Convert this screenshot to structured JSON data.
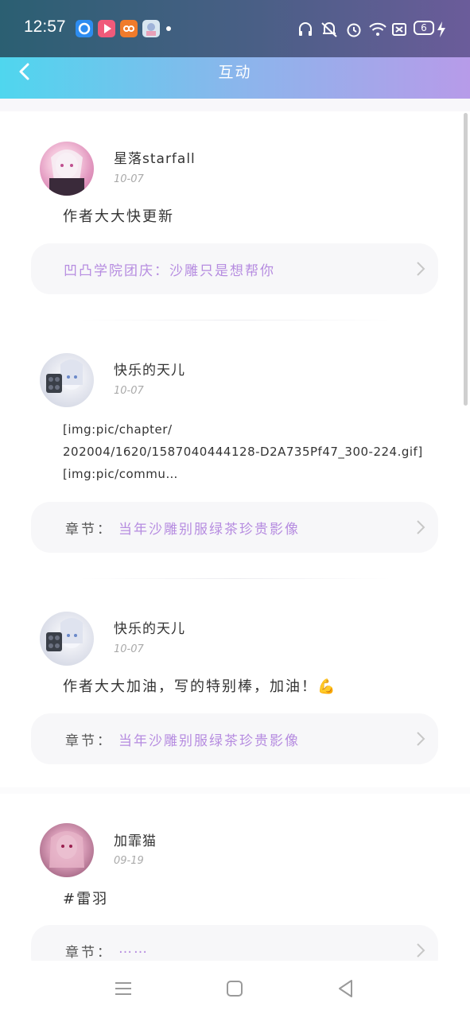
{
  "status_bar": {
    "time": "12:57",
    "apps": [
      "app-blue",
      "app-video",
      "app-orange",
      "app-anime"
    ],
    "battery": "6",
    "icons": [
      "headphones-icon",
      "mute-icon",
      "alarm-icon",
      "wifi-icon",
      "sim-icon",
      "battery-icon",
      "charging-icon"
    ]
  },
  "header": {
    "title": "互动",
    "back_icon": "chevron-left-icon"
  },
  "posts": [
    {
      "username": "星落starfall",
      "date": "10-07",
      "content": "作者大大快更新",
      "chapter_prefix": "",
      "chapter_title": "凹凸学院团庆：沙雕只是想帮你"
    },
    {
      "username": "快乐的天儿",
      "date": "10-07",
      "content_lines": [
        "[img:pic/chapter/",
        "202004/1620/1587040444128-D2A735Pf47_300-224.gif]",
        "[img:pic/commu…"
      ],
      "chapter_prefix": "章节：",
      "chapter_title": "当年沙雕别服绿茶珍贵影像"
    },
    {
      "username": "快乐的天儿",
      "date": "10-07",
      "content": "作者大大加油，写的特别棒，加油！💪",
      "chapter_prefix": "章节：",
      "chapter_title": "当年沙雕别服绿茶珍贵影像"
    },
    {
      "username": "加霏猫",
      "date": "09-19",
      "content": "#雷羽",
      "chapter_prefix": "章节：",
      "chapter_title": "……"
    }
  ],
  "colors": {
    "accent": "#b68ce0",
    "header_start": "#4fd6ee",
    "header_end": "#b79be9"
  }
}
